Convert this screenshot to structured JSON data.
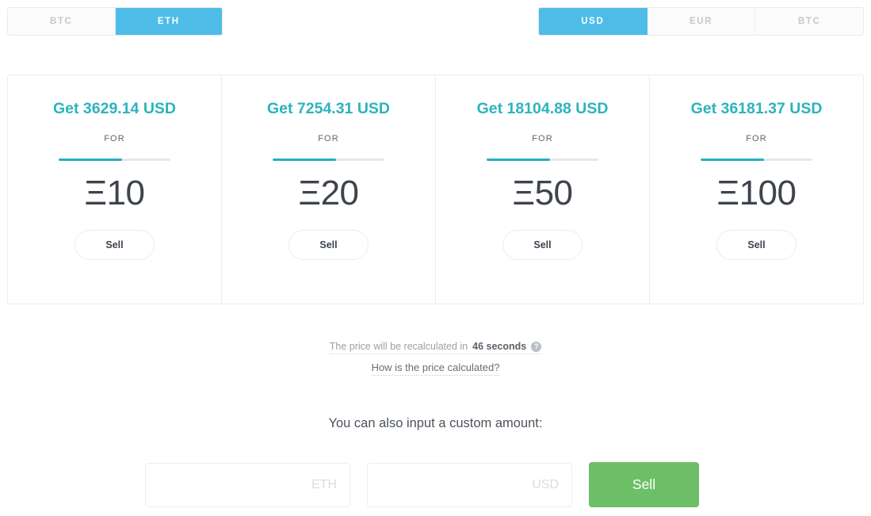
{
  "crypto_toggle": {
    "name": "crypto-selector",
    "options": [
      {
        "label": "BTC",
        "active": false
      },
      {
        "label": "ETH",
        "active": true
      }
    ]
  },
  "fiat_toggle": {
    "name": "currency-selector",
    "options": [
      {
        "label": "USD",
        "active": true
      },
      {
        "label": "EUR",
        "active": false
      },
      {
        "label": "BTC",
        "active": false
      }
    ]
  },
  "cards": [
    {
      "title": "Get 3629.14 USD",
      "for_label": "FOR",
      "symbol": "Ξ",
      "quantity": "10",
      "amount": "Ξ10",
      "progress_percent": 57,
      "button_label": "Sell"
    },
    {
      "title": "Get 7254.31 USD",
      "for_label": "FOR",
      "symbol": "Ξ",
      "quantity": "20",
      "amount": "Ξ20",
      "progress_percent": 57,
      "button_label": "Sell"
    },
    {
      "title": "Get 18104.88 USD",
      "for_label": "FOR",
      "symbol": "Ξ",
      "quantity": "50",
      "amount": "Ξ50",
      "progress_percent": 57,
      "button_label": "Sell"
    },
    {
      "title": "Get 36181.37 USD",
      "for_label": "FOR",
      "symbol": "Ξ",
      "quantity": "100",
      "amount": "Ξ100",
      "progress_percent": 57,
      "button_label": "Sell"
    }
  ],
  "notice": {
    "prefix": "The price will be recalculated in",
    "countdown": "46 seconds",
    "help_icon": "question-mark-icon",
    "help_glyph": "?",
    "link_label": "How is the price calculated?"
  },
  "custom": {
    "heading": "You can also input a custom amount:",
    "crypto_input": {
      "value": "",
      "placeholder": "ETH"
    },
    "fiat_input": {
      "value": "",
      "placeholder": "USD"
    },
    "submit_label": "Sell"
  },
  "colors": {
    "accent_blue": "#4fbce8",
    "accent_teal": "#2cb3be",
    "bar_teal": "#26aebf",
    "green": "#6cbf66",
    "text_dark": "#3e444c",
    "text_muted": "#9aa0a8",
    "border": "#ececee"
  }
}
